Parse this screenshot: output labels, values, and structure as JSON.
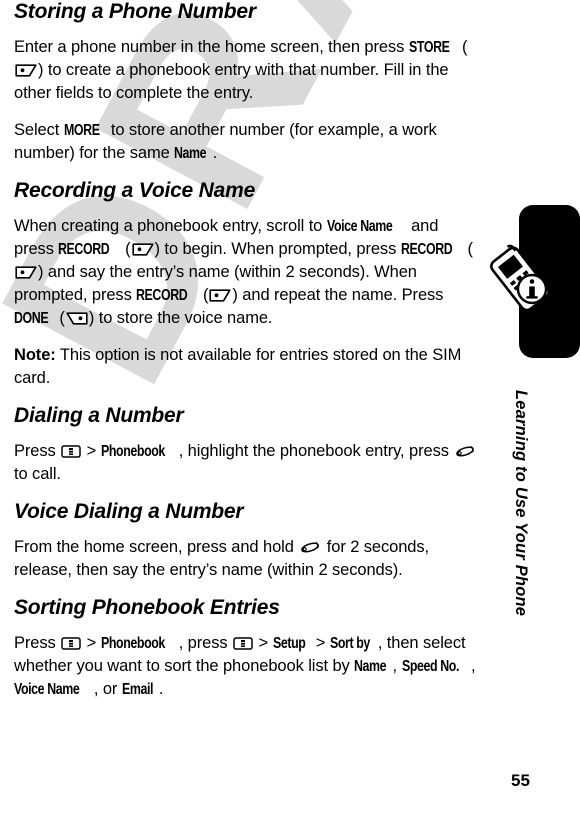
{
  "page": {
    "number": "55",
    "watermark": "DRAFT",
    "rail_title": "Learning to Use Your Phone"
  },
  "rail": {
    "tab_color": "#000000",
    "icon": "phone-info-icon"
  },
  "sections": [
    {
      "id": "storing-a-phone-number",
      "heading": "Storing a Phone Number",
      "paragraphs": [
        {
          "id": "storing-p1",
          "runs": [
            {
              "t": "text",
              "v": "Enter a phone number in the home screen, then press "
            },
            {
              "t": "cond",
              "v": "STORE"
            },
            {
              "t": "text",
              "v": " ("
            },
            {
              "t": "key",
              "v": "right-soft-key-icon"
            },
            {
              "t": "text",
              "v": ") to create a phonebook entry with that number. Fill in the other fields to complete the entry."
            }
          ]
        },
        {
          "id": "storing-p2",
          "runs": [
            {
              "t": "text",
              "v": "Select "
            },
            {
              "t": "cond",
              "v": "MORE"
            },
            {
              "t": "text",
              "v": " to store another number (for example, a work number) for the same "
            },
            {
              "t": "cond",
              "v": "Name"
            },
            {
              "t": "text",
              "v": "."
            }
          ]
        }
      ]
    },
    {
      "id": "recording-a-voice-name",
      "heading": "Recording a Voice Name",
      "paragraphs": [
        {
          "id": "recording-p1",
          "runs": [
            {
              "t": "text",
              "v": "When creating a phonebook entry, scroll to "
            },
            {
              "t": "cond",
              "v": "Voice Name"
            },
            {
              "t": "text",
              "v": " and press "
            },
            {
              "t": "cond",
              "v": "RECORD"
            },
            {
              "t": "text",
              "v": " ("
            },
            {
              "t": "key",
              "v": "right-soft-key-icon"
            },
            {
              "t": "text",
              "v": ") to begin. When prompted, press "
            },
            {
              "t": "cond",
              "v": "RECORD"
            },
            {
              "t": "text",
              "v": " ("
            },
            {
              "t": "key",
              "v": "right-soft-key-icon"
            },
            {
              "t": "text",
              "v": ") and say the entry’s name (within 2 seconds). When prompted, press "
            },
            {
              "t": "cond",
              "v": "RECORD"
            },
            {
              "t": "text",
              "v": " ("
            },
            {
              "t": "key",
              "v": "right-soft-key-icon"
            },
            {
              "t": "text",
              "v": ") and repeat the name. Press "
            },
            {
              "t": "cond",
              "v": "DONE"
            },
            {
              "t": "text",
              "v": " ("
            },
            {
              "t": "key",
              "v": "left-soft-key-icon"
            },
            {
              "t": "text",
              "v": ") to store the voice name."
            }
          ]
        },
        {
          "id": "recording-note",
          "runs": [
            {
              "t": "bold",
              "v": "Note:"
            },
            {
              "t": "text",
              "v": " This option is not available for entries stored on the SIM card."
            }
          ]
        }
      ]
    },
    {
      "id": "dialing-a-number",
      "heading": "Dialing a Number",
      "paragraphs": [
        {
          "id": "dialing-p1",
          "runs": [
            {
              "t": "text",
              "v": "Press "
            },
            {
              "t": "key",
              "v": "menu-key-icon"
            },
            {
              "t": "text",
              "v": " > "
            },
            {
              "t": "cond",
              "v": "Phonebook"
            },
            {
              "t": "text",
              "v": ", highlight the phonebook entry, press "
            },
            {
              "t": "key",
              "v": "send-key-icon"
            },
            {
              "t": "text",
              "v": " to call."
            }
          ]
        }
      ]
    },
    {
      "id": "voice-dialing-a-number",
      "heading": "Voice Dialing a Number",
      "paragraphs": [
        {
          "id": "voicedial-p1",
          "runs": [
            {
              "t": "text",
              "v": "From the home screen, press and hold "
            },
            {
              "t": "key",
              "v": "send-key-icon"
            },
            {
              "t": "text",
              "v": " for 2 seconds, release, then say the entry’s name (within 2 seconds)."
            }
          ]
        }
      ]
    },
    {
      "id": "sorting-phonebook-entries",
      "heading": "Sorting Phonebook Entries",
      "paragraphs": [
        {
          "id": "sorting-p1",
          "runs": [
            {
              "t": "text",
              "v": "Press "
            },
            {
              "t": "key",
              "v": "menu-key-icon"
            },
            {
              "t": "text",
              "v": " > "
            },
            {
              "t": "cond",
              "v": "Phonebook"
            },
            {
              "t": "text",
              "v": ", press "
            },
            {
              "t": "key",
              "v": "menu-key-icon"
            },
            {
              "t": "text",
              "v": " > "
            },
            {
              "t": "cond",
              "v": "Setup"
            },
            {
              "t": "text",
              "v": " > "
            },
            {
              "t": "cond",
              "v": "Sort by"
            },
            {
              "t": "text",
              "v": ", then select whether you want to sort the phonebook list by "
            },
            {
              "t": "cond",
              "v": "Name"
            },
            {
              "t": "text",
              "v": ", "
            },
            {
              "t": "cond",
              "v": "Speed No."
            },
            {
              "t": "text",
              "v": ", "
            },
            {
              "t": "cond",
              "v": "Voice Name"
            },
            {
              "t": "text",
              "v": ", or "
            },
            {
              "t": "cond",
              "v": "Email"
            },
            {
              "t": "text",
              "v": "."
            }
          ]
        }
      ]
    }
  ]
}
